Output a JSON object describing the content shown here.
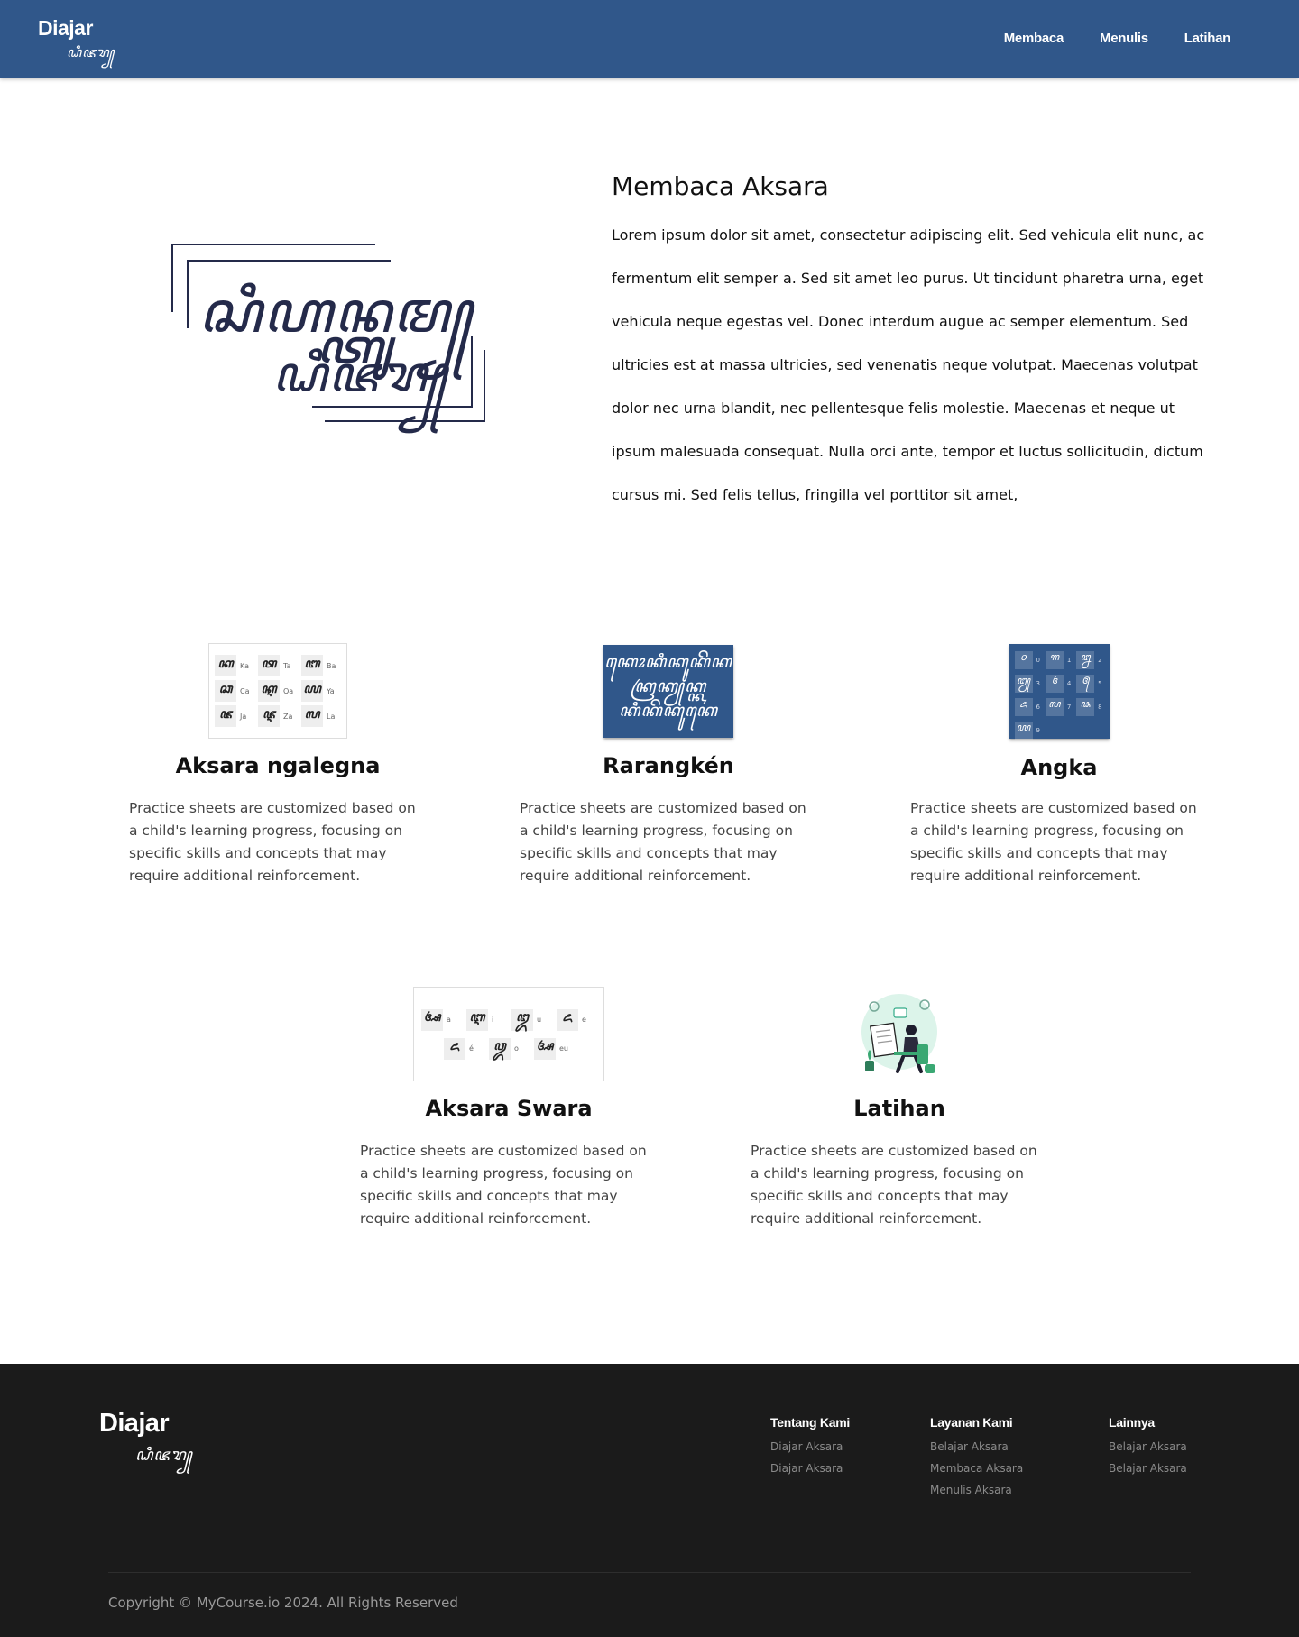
{
  "header": {
    "brand": "Diajar",
    "brand_script": "ꦝꦶꦗꦫ꧀",
    "nav": [
      "Membaca",
      "Menulis",
      "Latihan"
    ]
  },
  "hero": {
    "logo_line1": "ꦱꦶꦲꦤ꧀ꦠꦸꦩ꧀",
    "logo_line2": "ꦝꦶꦗꦫ꧀",
    "title": "Membaca Aksara",
    "body": "Lorem ipsum dolor sit amet, consectetur adipiscing elit. Sed vehicula elit nunc, ac fermentum elit semper a. Sed sit amet leo purus. Ut tincidunt pharetra urna, eget vehicula neque egestas vel. Donec interdum augue ac semper elementum. Sed ultricies est at massa ultricies, sed venenatis neque volutpat. Maecenas volutpat dolor nec urna blandit, nec pellentesque felis molestie. Maecenas et neque ut ipsum malesuada consequat. Nulla orci ante, tempor et luctus sollicitudin, dictum cursus mi. Sed felis tellus, fringilla vel porttitor sit amet,"
  },
  "cards": [
    {
      "title": "Aksara ngalegna",
      "desc": "Practice sheets are customized based on a child's learning progress, focusing on specific skills and concepts that may require additional reinforcement.",
      "tiles": [
        {
          "g": "ꦏ",
          "l": "Ka"
        },
        {
          "g": "ꦠ",
          "l": "Ta"
        },
        {
          "g": "ꦧ",
          "l": "Ba"
        },
        {
          "g": "ꦕ",
          "l": "Ca"
        },
        {
          "g": "ꦐ",
          "l": "Qa"
        },
        {
          "g": "ꦪ",
          "l": "Ya"
        },
        {
          "g": "ꦗ",
          "l": "Ja"
        },
        {
          "g": "ꦘ",
          "l": "Za"
        },
        {
          "g": "ꦭ",
          "l": "La"
        }
      ]
    },
    {
      "title": "Rarangkén",
      "desc": "Practice sheets are customized based on a child's learning progress, focusing on specific skills and concepts that may require additional reinforcement.",
      "lines": [
        "ꦏꦺꦴꦏꦶꦏꦸꦏꦼꦏ",
        "ꦏꦿꦏꦾꦏ꧀ꦏ",
        "ꦏꦶꦏꦼꦏꦸꦏꦺ"
      ]
    },
    {
      "title": "Angka",
      "desc": "Practice sheets are customized based on a child's learning progress, focusing on specific skills and concepts that may require additional reinforcement.",
      "nums": [
        {
          "g": "꧐",
          "l": "0"
        },
        {
          "g": "꧑",
          "l": "1"
        },
        {
          "g": "꧒",
          "l": "2"
        },
        {
          "g": "꧓",
          "l": "3"
        },
        {
          "g": "꧔",
          "l": "4"
        },
        {
          "g": "꧕",
          "l": "5"
        },
        {
          "g": "꧖",
          "l": "6"
        },
        {
          "g": "꧗",
          "l": "7"
        },
        {
          "g": "꧘",
          "l": "8"
        },
        {
          "g": "꧙",
          "l": "9"
        }
      ]
    },
    {
      "title": "Aksara Swara",
      "desc": "Practice sheets are customized based on a child's learning progress, focusing on specific skills and concepts that may require additional reinforcement.",
      "tiles": [
        {
          "g": "ꦄ",
          "l": "a"
        },
        {
          "g": "ꦆ",
          "l": "i"
        },
        {
          "g": "ꦈ",
          "l": "u"
        },
        {
          "g": "ꦌ",
          "l": "e"
        },
        {
          "g": "ꦌ",
          "l": "é"
        },
        {
          "g": "ꦎ",
          "l": "o"
        },
        {
          "g": "ꦄ",
          "l": "eu"
        }
      ]
    },
    {
      "title": "Latihan",
      "desc": "Practice sheets are customized based on a child's learning progress, focusing on specific skills and concepts that may require additional reinforcement."
    }
  ],
  "footer": {
    "brand": "Diajar",
    "brand_script": "ꦝꦶꦗꦫ꧀",
    "columns": [
      {
        "title": "Tentang Kami",
        "links": [
          "Diajar Aksara",
          "Diajar Aksara"
        ]
      },
      {
        "title": "Layanan Kami",
        "links": [
          "Belajar Aksara",
          "Membaca Aksara",
          "Menulis Aksara"
        ]
      },
      {
        "title": "Lainnya",
        "links": [
          "Belajar Aksara",
          "Belajar Aksara"
        ]
      }
    ],
    "copyright": "Copyright © MyCourse.io 2024. All Rights Reserved"
  }
}
